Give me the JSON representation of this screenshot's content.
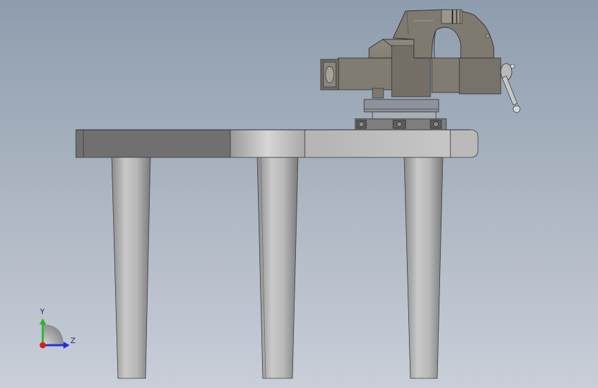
{
  "viewport": {
    "background_top": "#8e9dae",
    "background_bottom": "#c9ced8"
  },
  "triad": {
    "y_label": "Y",
    "z_label": "Z",
    "y_color": "#2db52d",
    "z_color": "#1f2fd6",
    "x_color": "#d42020"
  },
  "model": {
    "parts": [
      "workbench-top",
      "table-leg",
      "table-leg",
      "table-leg",
      "bench-vise"
    ]
  }
}
